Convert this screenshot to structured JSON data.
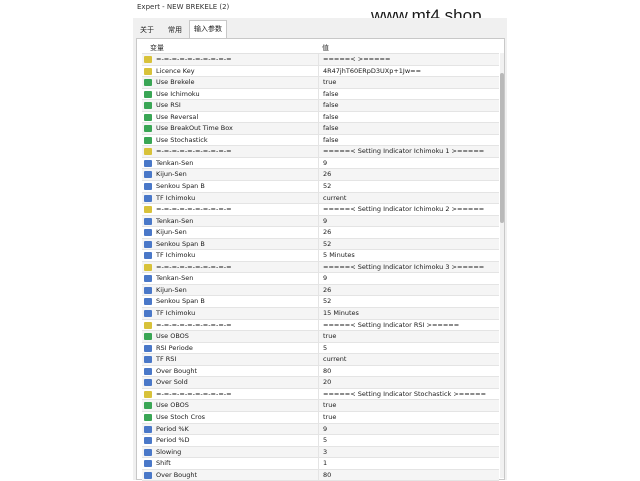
{
  "window": {
    "title": "Expert - NEW BREKELE (2)"
  },
  "watermark": "www.mt4.shop",
  "tabs": [
    {
      "label": "关于",
      "active": false
    },
    {
      "label": "常用",
      "active": false
    },
    {
      "label": "输入参数",
      "active": true
    }
  ],
  "grid": {
    "headers": {
      "variable": "变量",
      "value": "值"
    },
    "rows": [
      {
        "type": "text",
        "name": "=-=-=-=-=-=-=-=-=-=",
        "value": "=====<              >====="
      },
      {
        "type": "text",
        "name": "Licence Key",
        "value": "4R47jhT60ERpD3UXp+1Jw=="
      },
      {
        "type": "bool",
        "name": "Use Brekele",
        "value": "true"
      },
      {
        "type": "bool",
        "name": "Use Ichimoku",
        "value": "false"
      },
      {
        "type": "bool",
        "name": "Use RSI",
        "value": "false"
      },
      {
        "type": "bool",
        "name": "Use Reversal",
        "value": "false"
      },
      {
        "type": "bool",
        "name": "Use BreakOut Time Box",
        "value": "false"
      },
      {
        "type": "bool",
        "name": "Use Stochastick",
        "value": "false"
      },
      {
        "type": "text",
        "name": "=-=-=-=-=-=-=-=-=-=",
        "value": "=====< Setting Indicator Ichimoku 1 >====="
      },
      {
        "type": "num",
        "name": "Tenkan-Sen",
        "value": "9"
      },
      {
        "type": "num",
        "name": "Kijun-Sen",
        "value": "26"
      },
      {
        "type": "num",
        "name": "Senkou Span B",
        "value": "52"
      },
      {
        "type": "tf",
        "name": "TF Ichimoku",
        "value": "current"
      },
      {
        "type": "text",
        "name": "=-=-=-=-=-=-=-=-=-=",
        "value": "=====< Setting Indicator Ichimoku 2 >====="
      },
      {
        "type": "num",
        "name": "Tenkan-Sen",
        "value": "9"
      },
      {
        "type": "num",
        "name": "Kijun-Sen",
        "value": "26"
      },
      {
        "type": "num",
        "name": "Senkou Span B",
        "value": "52"
      },
      {
        "type": "tf",
        "name": "TF Ichimoku",
        "value": "5 Minutes"
      },
      {
        "type": "text",
        "name": "=-=-=-=-=-=-=-=-=-=",
        "value": "=====< Setting Indicator Ichimoku 3 >====="
      },
      {
        "type": "num",
        "name": "Tenkan-Sen",
        "value": "9"
      },
      {
        "type": "num",
        "name": "Kijun-Sen",
        "value": "26"
      },
      {
        "type": "num",
        "name": "Senkou Span B",
        "value": "52"
      },
      {
        "type": "tf",
        "name": "TF Ichimoku",
        "value": "15 Minutes"
      },
      {
        "type": "text",
        "name": "=-=-=-=-=-=-=-=-=-=",
        "value": "=====< Setting Indicator RSI >====="
      },
      {
        "type": "bool",
        "name": "Use OBOS",
        "value": "true"
      },
      {
        "type": "num",
        "name": "RSI Periode",
        "value": "5"
      },
      {
        "type": "tf",
        "name": "TF RSI",
        "value": "current"
      },
      {
        "type": "num",
        "name": "Over Bought",
        "value": "80"
      },
      {
        "type": "num",
        "name": "Over Sold",
        "value": "20"
      },
      {
        "type": "text",
        "name": "=-=-=-=-=-=-=-=-=-=",
        "value": "=====< Setting Indicator Stochastick >====="
      },
      {
        "type": "bool",
        "name": "Use OBOS",
        "value": "true"
      },
      {
        "type": "bool",
        "name": "Use Stoch Cros",
        "value": "true"
      },
      {
        "type": "num",
        "name": "Period %K",
        "value": "9"
      },
      {
        "type": "num",
        "name": "Period %D",
        "value": "5"
      },
      {
        "type": "num",
        "name": "Slowing",
        "value": "3"
      },
      {
        "type": "num",
        "name": "Shift",
        "value": "1"
      },
      {
        "type": "num",
        "name": "Over Bought",
        "value": "80"
      }
    ]
  }
}
